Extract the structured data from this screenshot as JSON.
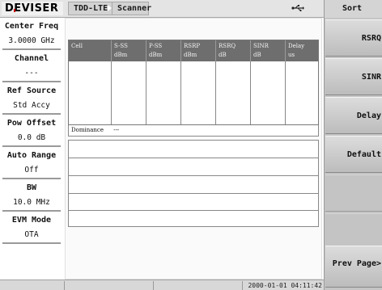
{
  "brand": "DEVISER",
  "mode_tabs": [
    "TDD-LTE",
    "Scanner"
  ],
  "status_icon": "usb-icon",
  "parameters": [
    {
      "label": "Center Freq",
      "value": "3.0000 GHz"
    },
    {
      "label": "Channel",
      "value": "---"
    },
    {
      "label": "Ref Source",
      "value": "Std Accy"
    },
    {
      "label": "Pow Offset",
      "value": "0.0 dB"
    },
    {
      "label": "Auto Range",
      "value": "Off"
    },
    {
      "label": "BW",
      "value": "10.0 MHz"
    },
    {
      "label": "EVM Mode",
      "value": "OTA"
    }
  ],
  "table": {
    "columns": [
      {
        "name": "Cell",
        "unit": ""
      },
      {
        "name": "S-SS",
        "unit": "dBm"
      },
      {
        "name": "P-SS",
        "unit": "dBm"
      },
      {
        "name": "RSRP",
        "unit": "dBm"
      },
      {
        "name": "RSRQ",
        "unit": "dB"
      },
      {
        "name": "SINR",
        "unit": "dB"
      },
      {
        "name": "Delay",
        "unit": "us"
      }
    ],
    "rows": []
  },
  "dominance": {
    "label": "Dominance",
    "value": "---"
  },
  "timestamp": "2000-01-01 04:11:42",
  "softkey_menu": {
    "title": "Sort",
    "keys": [
      "RSRQ",
      "SINR",
      "Delay",
      "Default",
      "",
      "",
      "Prev Page>"
    ]
  },
  "colors": {
    "header_fill": "#6e6e6e",
    "softkey_fill": "#c4c4c4",
    "logo_accent": "#cc0000"
  }
}
